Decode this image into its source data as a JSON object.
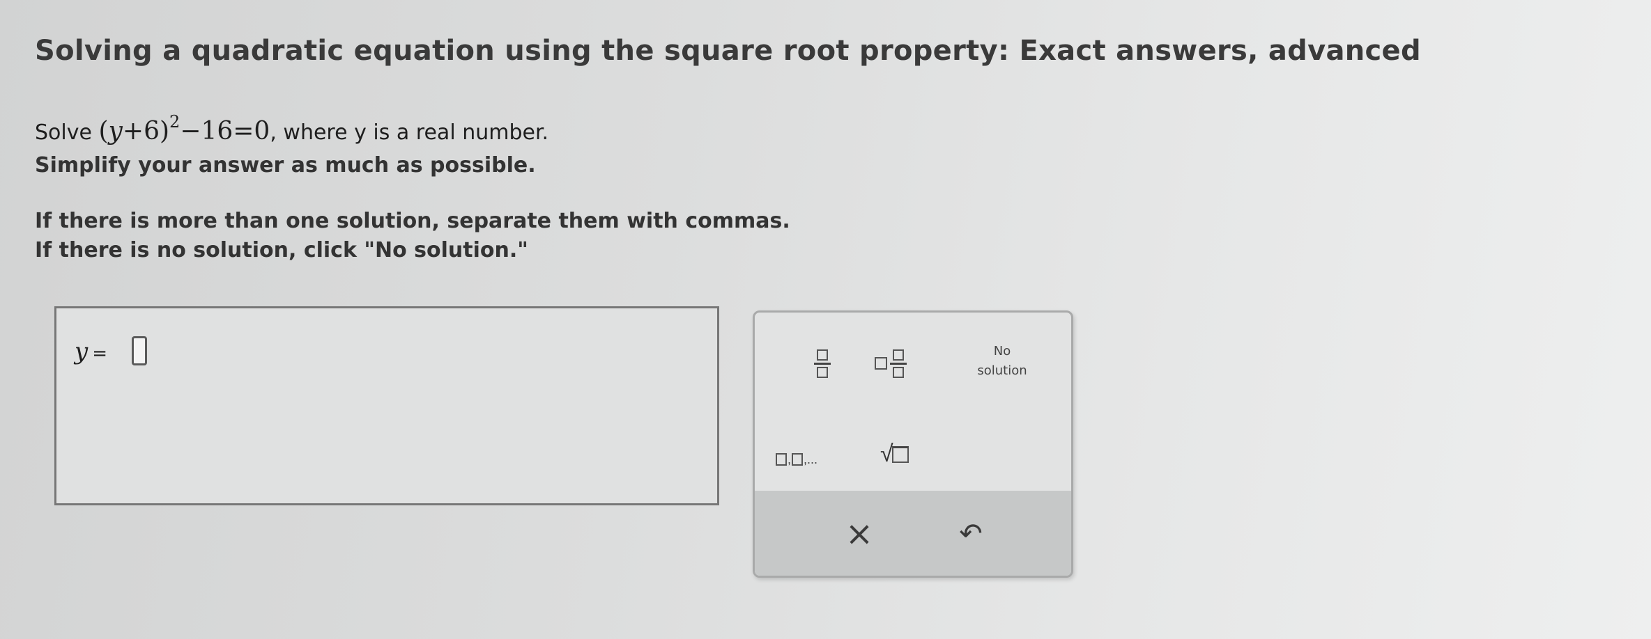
{
  "title": "Solving a quadratic equation using the square root property: Exact answers, advanced",
  "instructions": {
    "solve_prefix": "Solve",
    "equation": {
      "open": "(",
      "var": "y",
      "plus": "+",
      "six": "6",
      "close": ")",
      "exponent": "2",
      "rest": "−16=0"
    },
    "solve_suffix": ", where y is a real number.",
    "simplify": "Simplify your answer as much as possible.",
    "multiple": "If there is more than one solution, separate them with commas.",
    "none": "If there is no solution, click \"No solution.\""
  },
  "answer": {
    "variable": "y",
    "equals": "=",
    "value": ""
  },
  "keypad": {
    "no_solution_line1": "No",
    "no_solution_line2": "solution",
    "list_separator": ",",
    "list_ellipsis": ",...",
    "radical": "√",
    "clear_icon": "×",
    "undo_icon": "↶"
  },
  "icons": {
    "clear": "close-icon",
    "undo": "undo-icon",
    "fraction": "fraction-icon",
    "mixed": "mixed-number-icon",
    "list": "list-icon",
    "sqrt": "square-root-icon"
  }
}
